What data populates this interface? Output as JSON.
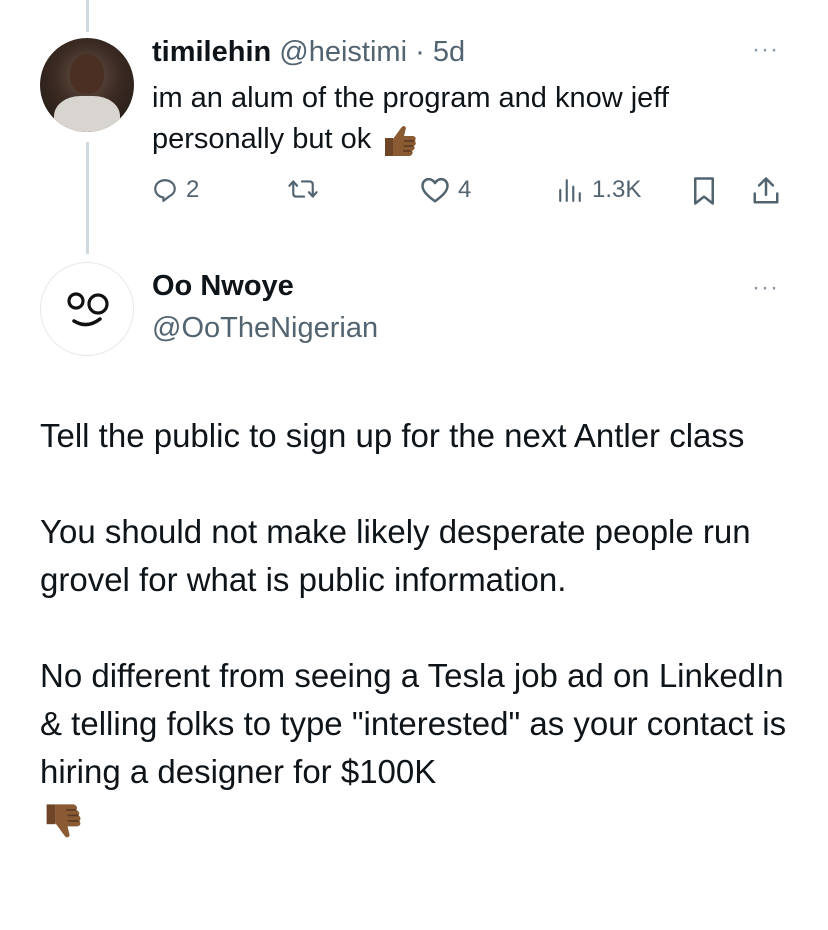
{
  "tweet1": {
    "display_name": "timilehin",
    "handle": "@heistimi",
    "separator": "·",
    "time": "5d",
    "text": "im an alum of the program and know jeff personally but ok",
    "emoji": "thumbs-up-dark-skin",
    "replies": "2",
    "retweets": "",
    "likes": "4",
    "views": "1.3K"
  },
  "tweet2": {
    "display_name": "Oo Nwoye",
    "handle": "@OoTheNigerian",
    "paragraphs": [
      "Tell the public to sign up for the next Antler class",
      "You should not make likely desperate people run grovel for what is public information.",
      "No different from seeing a Tesla job ad on LinkedIn & telling folks to type \"interested\" as your contact is hiring a designer for $100K"
    ],
    "trailing_emoji": "thumbs-down-dark-skin"
  },
  "more_menu": "···",
  "colors": {
    "text": "#0f1419",
    "secondary": "#536471",
    "thread_line": "#cfd9de",
    "emoji_skin": "#8a5a33"
  },
  "icons": [
    "reply-icon",
    "retweet-icon",
    "like-icon",
    "views-icon",
    "bookmark-icon",
    "share-icon",
    "more-icon"
  ]
}
